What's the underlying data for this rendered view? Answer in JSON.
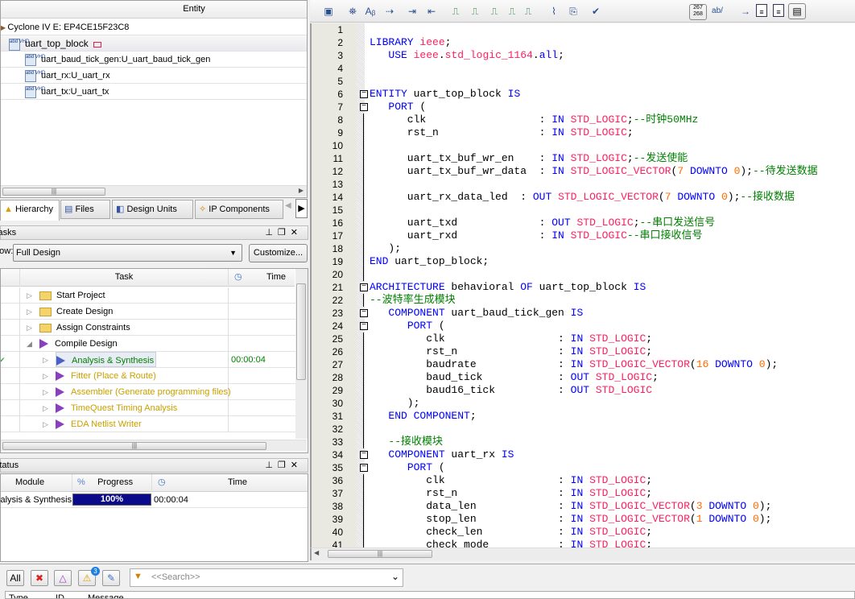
{
  "hierarchy": {
    "header": "Entity",
    "device": "Cyclone IV E: EP4CE15F23C8",
    "top": "uart_top_block",
    "children": [
      "uart_baud_tick_gen:U_uart_baud_tick_gen",
      "uart_rx:U_uart_rx",
      "uart_tx:U_uart_tx"
    ],
    "icon_label": "abd VHD",
    "tabs": [
      "Hierarchy",
      "Files",
      "Design Units",
      "IP Components"
    ]
  },
  "tasks": {
    "title": "Tasks",
    "flow_label": "Flow:",
    "flow_value": "Full Design",
    "customize": "Customize...",
    "col_task": "Task",
    "col_time": "Time",
    "items": [
      {
        "label": "Start Project",
        "type": "folder",
        "time": "",
        "color": "#000000"
      },
      {
        "label": "Create Design",
        "type": "folder",
        "time": "",
        "color": "#000000"
      },
      {
        "label": "Assign Constraints",
        "type": "folder",
        "time": "",
        "color": "#000000"
      },
      {
        "label": "Compile Design",
        "type": "play",
        "time": "",
        "color": "#000000"
      },
      {
        "label": "Analysis & Synthesis",
        "type": "play",
        "time": "00:00:04",
        "color": "#008000"
      },
      {
        "label": "Fitter (Place & Route)",
        "type": "play",
        "time": "",
        "color": "#c8a000"
      },
      {
        "label": "Assembler (Generate programming files)",
        "type": "play",
        "time": "",
        "color": "#c8a000"
      },
      {
        "label": "TimeQuest Timing Analysis",
        "type": "play",
        "time": "",
        "color": "#c8a000"
      },
      {
        "label": "EDA Netlist Writer",
        "type": "play",
        "time": "",
        "color": "#c8a000"
      }
    ]
  },
  "status": {
    "title": "Status",
    "col_module": "Module",
    "col_progress": "Progress",
    "col_time": "Time",
    "row": {
      "module": "Analysis & Synthesis",
      "progress": "100%",
      "progress_value": 100,
      "time": "00:00:04"
    }
  },
  "toolbar": {
    "icons": [
      "open-file-icon",
      "find-icon",
      "replace-icon",
      "goto-bracket-icon",
      "indent-icon",
      "unindent-icon",
      "bookmark-icon",
      "next-bookmark-icon",
      "prev-bookmark-icon",
      "remove-bookmark-icon",
      "remove-all-bookmarks-icon",
      "attach-icon",
      "template-icon",
      "syntax-check-icon"
    ],
    "line_numbers": "267 268",
    "wrap": "ab/"
  },
  "code": [
    [],
    [
      [
        "kw",
        "LIBRARY"
      ],
      [
        "pl",
        " "
      ],
      [
        "ty",
        "ieee"
      ],
      [
        "pl",
        ";"
      ]
    ],
    [
      [
        "pl",
        "   "
      ],
      [
        "kw",
        "USE"
      ],
      [
        "pl",
        " "
      ],
      [
        "ty",
        "ieee"
      ],
      [
        "pl",
        "."
      ],
      [
        "ty",
        "std_logic_1164"
      ],
      [
        "pl",
        "."
      ],
      [
        "kw",
        "all"
      ],
      [
        "pl",
        ";"
      ]
    ],
    [],
    [],
    [
      [
        "kw",
        "ENTITY"
      ],
      [
        "pl",
        " uart_top_block "
      ],
      [
        "kw",
        "IS"
      ]
    ],
    [
      [
        "pl",
        "   "
      ],
      [
        "kw",
        "PORT"
      ],
      [
        "pl",
        " ("
      ]
    ],
    [
      [
        "pl",
        "      clk                  : "
      ],
      [
        "kw",
        "IN"
      ],
      [
        "pl",
        " "
      ],
      [
        "ty",
        "STD_LOGIC"
      ],
      [
        "pl",
        ";"
      ],
      [
        "cm",
        "--时钟50MHz"
      ]
    ],
    [
      [
        "pl",
        "      rst_n                : "
      ],
      [
        "kw",
        "IN"
      ],
      [
        "pl",
        " "
      ],
      [
        "ty",
        "STD_LOGIC"
      ],
      [
        "pl",
        ";"
      ]
    ],
    [],
    [
      [
        "pl",
        "      uart_tx_buf_wr_en    : "
      ],
      [
        "kw",
        "IN"
      ],
      [
        "pl",
        " "
      ],
      [
        "ty",
        "STD_LOGIC"
      ],
      [
        "pl",
        ";"
      ],
      [
        "cm",
        "--发送使能"
      ]
    ],
    [
      [
        "pl",
        "      uart_tx_buf_wr_data  : "
      ],
      [
        "kw",
        "IN"
      ],
      [
        "pl",
        " "
      ],
      [
        "ty",
        "STD_LOGIC_VECTOR"
      ],
      [
        "pl",
        "("
      ],
      [
        "nm",
        "7"
      ],
      [
        "pl",
        " "
      ],
      [
        "kw",
        "DOWNTO"
      ],
      [
        "pl",
        " "
      ],
      [
        "nm",
        "0"
      ],
      [
        "pl",
        ");"
      ],
      [
        "cm",
        "--待发送数据"
      ]
    ],
    [],
    [
      [
        "pl",
        "      uart_rx_data_led  : "
      ],
      [
        "kw",
        "OUT"
      ],
      [
        "pl",
        " "
      ],
      [
        "ty",
        "STD_LOGIC_VECTOR"
      ],
      [
        "pl",
        "("
      ],
      [
        "nm",
        "7"
      ],
      [
        "pl",
        " "
      ],
      [
        "kw",
        "DOWNTO"
      ],
      [
        "pl",
        " "
      ],
      [
        "nm",
        "0"
      ],
      [
        "pl",
        ");"
      ],
      [
        "cm",
        "--接收数据"
      ]
    ],
    [],
    [
      [
        "pl",
        "      uart_txd             : "
      ],
      [
        "kw",
        "OUT"
      ],
      [
        "pl",
        " "
      ],
      [
        "ty",
        "STD_LOGIC"
      ],
      [
        "pl",
        ";"
      ],
      [
        "cm",
        "--串口发送信号"
      ]
    ],
    [
      [
        "pl",
        "      uart_rxd             : "
      ],
      [
        "kw",
        "IN"
      ],
      [
        "pl",
        " "
      ],
      [
        "ty",
        "STD_LOGIC"
      ],
      [
        "cm",
        "--串口接收信号"
      ]
    ],
    [
      [
        "pl",
        "   );"
      ]
    ],
    [
      [
        "kw",
        "END"
      ],
      [
        "pl",
        " uart_top_block;"
      ]
    ],
    [],
    [
      [
        "kw",
        "ARCHITECTURE"
      ],
      [
        "pl",
        " behavioral "
      ],
      [
        "kw",
        "OF"
      ],
      [
        "pl",
        " uart_top_block "
      ],
      [
        "kw",
        "IS"
      ]
    ],
    [
      [
        "cm",
        "--波特率生成模块"
      ]
    ],
    [
      [
        "pl",
        "   "
      ],
      [
        "kw",
        "COMPONENT"
      ],
      [
        "pl",
        " uart_baud_tick_gen "
      ],
      [
        "kw",
        "IS"
      ]
    ],
    [
      [
        "pl",
        "      "
      ],
      [
        "kw",
        "PORT"
      ],
      [
        "pl",
        " ("
      ]
    ],
    [
      [
        "pl",
        "         clk                  : "
      ],
      [
        "kw",
        "IN"
      ],
      [
        "pl",
        " "
      ],
      [
        "ty",
        "STD_LOGIC"
      ],
      [
        "pl",
        ";"
      ]
    ],
    [
      [
        "pl",
        "         rst_n                : "
      ],
      [
        "kw",
        "IN"
      ],
      [
        "pl",
        " "
      ],
      [
        "ty",
        "STD_LOGIC"
      ],
      [
        "pl",
        ";"
      ]
    ],
    [
      [
        "pl",
        "         baudrate             : "
      ],
      [
        "kw",
        "IN"
      ],
      [
        "pl",
        " "
      ],
      [
        "ty",
        "STD_LOGIC_VECTOR"
      ],
      [
        "pl",
        "("
      ],
      [
        "nm",
        "16"
      ],
      [
        "pl",
        " "
      ],
      [
        "kw",
        "DOWNTO"
      ],
      [
        "pl",
        " "
      ],
      [
        "nm",
        "0"
      ],
      [
        "pl",
        ");"
      ]
    ],
    [
      [
        "pl",
        "         baud_tick            : "
      ],
      [
        "kw",
        "OUT"
      ],
      [
        "pl",
        " "
      ],
      [
        "ty",
        "STD_LOGIC"
      ],
      [
        "pl",
        ";"
      ]
    ],
    [
      [
        "pl",
        "         baud16_tick          : "
      ],
      [
        "kw",
        "OUT"
      ],
      [
        "pl",
        " "
      ],
      [
        "ty",
        "STD_LOGIC"
      ]
    ],
    [
      [
        "pl",
        "      );"
      ]
    ],
    [
      [
        "pl",
        "   "
      ],
      [
        "kw",
        "END COMPONENT"
      ],
      [
        "pl",
        ";"
      ]
    ],
    [],
    [
      [
        "pl",
        "   "
      ],
      [
        "cm",
        "--接收模块"
      ]
    ],
    [
      [
        "pl",
        "   "
      ],
      [
        "kw",
        "COMPONENT"
      ],
      [
        "pl",
        " uart_rx "
      ],
      [
        "kw",
        "IS"
      ]
    ],
    [
      [
        "pl",
        "      "
      ],
      [
        "kw",
        "PORT"
      ],
      [
        "pl",
        " ("
      ]
    ],
    [
      [
        "pl",
        "         clk                  : "
      ],
      [
        "kw",
        "IN"
      ],
      [
        "pl",
        " "
      ],
      [
        "ty",
        "STD_LOGIC"
      ],
      [
        "pl",
        ";"
      ]
    ],
    [
      [
        "pl",
        "         rst_n                : "
      ],
      [
        "kw",
        "IN"
      ],
      [
        "pl",
        " "
      ],
      [
        "ty",
        "STD_LOGIC"
      ],
      [
        "pl",
        ";"
      ]
    ],
    [
      [
        "pl",
        "         data_len             : "
      ],
      [
        "kw",
        "IN"
      ],
      [
        "pl",
        " "
      ],
      [
        "ty",
        "STD_LOGIC_VECTOR"
      ],
      [
        "pl",
        "("
      ],
      [
        "nm",
        "3"
      ],
      [
        "pl",
        " "
      ],
      [
        "kw",
        "DOWNTO"
      ],
      [
        "pl",
        " "
      ],
      [
        "nm",
        "0"
      ],
      [
        "pl",
        ");"
      ]
    ],
    [
      [
        "pl",
        "         stop_len             : "
      ],
      [
        "kw",
        "IN"
      ],
      [
        "pl",
        " "
      ],
      [
        "ty",
        "STD_LOGIC_VECTOR"
      ],
      [
        "pl",
        "("
      ],
      [
        "nm",
        "1"
      ],
      [
        "pl",
        " "
      ],
      [
        "kw",
        "DOWNTO"
      ],
      [
        "pl",
        " "
      ],
      [
        "nm",
        "0"
      ],
      [
        "pl",
        ");"
      ]
    ],
    [
      [
        "pl",
        "         check_len            : "
      ],
      [
        "kw",
        "IN"
      ],
      [
        "pl",
        " "
      ],
      [
        "ty",
        "STD_LOGIC"
      ],
      [
        "pl",
        ";"
      ]
    ],
    [
      [
        "pl",
        "         check_mode           : "
      ],
      [
        "kw",
        "IN"
      ],
      [
        "pl",
        " "
      ],
      [
        "ty",
        "STD_LOGIC"
      ],
      [
        "pl",
        ";"
      ]
    ]
  ],
  "fold_lines": [
    6,
    7,
    21,
    23,
    24,
    34,
    35
  ],
  "messages": {
    "all": "All",
    "warning_count": "3",
    "search_placeholder": "<<Search>>",
    "cols": [
      "Type",
      "ID",
      "Message"
    ]
  }
}
